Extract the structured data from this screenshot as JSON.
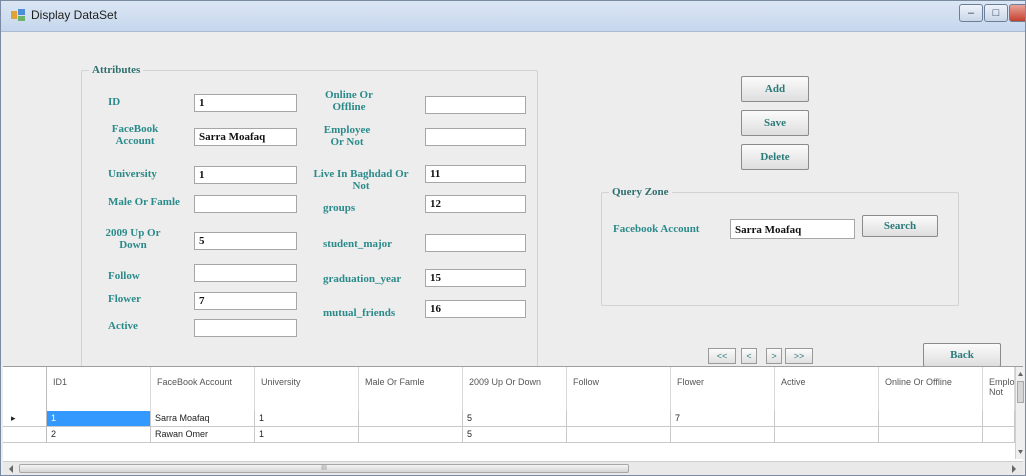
{
  "window": {
    "title": "Display DataSet",
    "controls": {
      "minimize": "–",
      "maximize": "□",
      "close": "x"
    }
  },
  "attributes": {
    "group_label": "Attributes",
    "fields": {
      "id": {
        "label": "ID",
        "value": "1"
      },
      "facebook_account": {
        "label": "FaceBook Account",
        "value": "Sarra Moafaq"
      },
      "university": {
        "label": "University",
        "value": "1"
      },
      "male_or_famle": {
        "label": "Male Or Famle",
        "value": ""
      },
      "up_or_down_2009": {
        "label": "2009 Up Or Down",
        "value": "5"
      },
      "follow": {
        "label": "Follow",
        "value": ""
      },
      "flower": {
        "label": "Flower",
        "value": "7"
      },
      "active": {
        "label": "Active",
        "value": ""
      },
      "online_or_offline": {
        "label": "Online Or Offline",
        "value": ""
      },
      "employee_or_not": {
        "label": "Employee Or Not",
        "value": ""
      },
      "live_in_baghdad": {
        "label": "Live In Baghdad Or Not",
        "value": "11"
      },
      "groups": {
        "label": "groups",
        "value": "12"
      },
      "student_major": {
        "label": "student_major",
        "value": ""
      },
      "graduation_year": {
        "label": "graduation_year",
        "value": "15"
      },
      "mutual_friends": {
        "label": "mutual_friends",
        "value": "16"
      }
    }
  },
  "actions": {
    "add": "Add",
    "save": "Save",
    "delete": "Delete",
    "back": "Back"
  },
  "query": {
    "group_label": "Query Zone",
    "label": "Facebook Account",
    "value": "Sarra Moafaq",
    "search": "Search"
  },
  "navigation": {
    "first": "<<",
    "prev": "<",
    "next": ">",
    "last": ">>"
  },
  "grid": {
    "columns": [
      "ID1",
      "FaceBook Account",
      "University",
      "Male Or Famle",
      "2009 Up Or Down",
      "Follow",
      "Flower",
      "Active",
      "Online Or Offline",
      "Emplo Not"
    ],
    "rows": [
      [
        "1",
        "Sarra Moafaq",
        "1",
        "",
        "5",
        "",
        "7",
        "",
        "",
        ""
      ],
      [
        "2",
        "Rawan Omer",
        "1",
        "",
        "5",
        "",
        "",
        "",
        "",
        ""
      ]
    ],
    "current_row_marker": "▸",
    "scroll_grip": "III"
  },
  "colors": {
    "label_teal": "#2b8a8a",
    "selection_blue": "#3399ff"
  }
}
